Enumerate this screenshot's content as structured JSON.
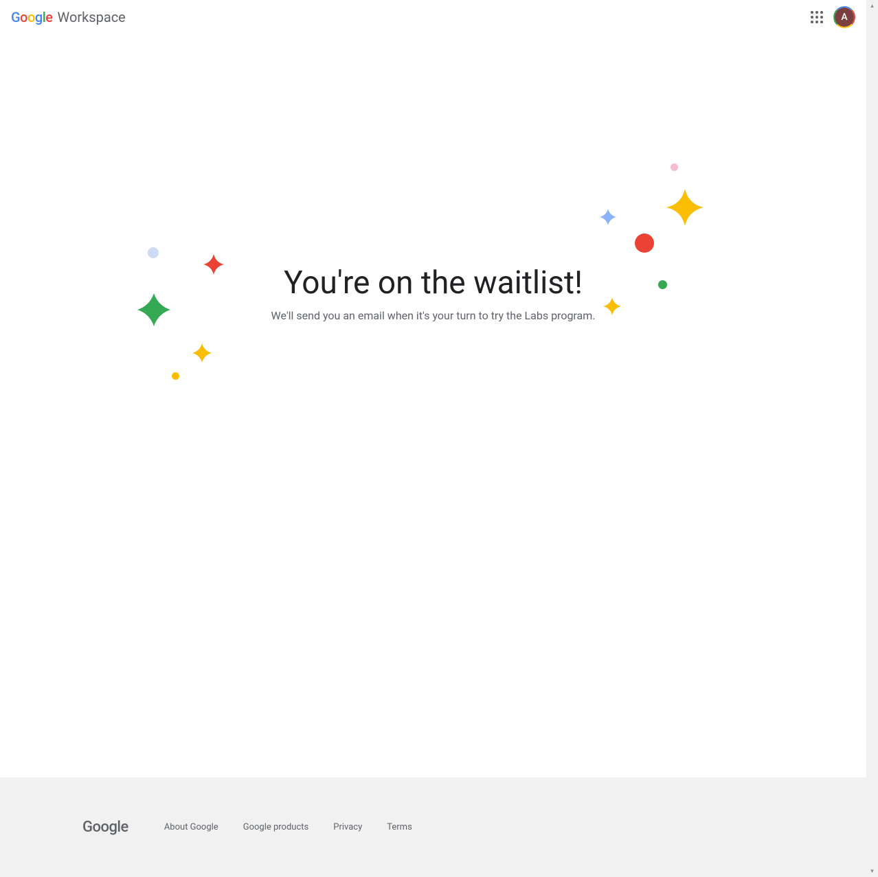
{
  "header": {
    "product": "Workspace",
    "avatar_initial": "A"
  },
  "main": {
    "headline": "You're on the waitlist!",
    "subhead": "We'll send you an email when it's your turn to try the Labs program."
  },
  "footer": {
    "logo": "Google",
    "links": [
      "About Google",
      "Google products",
      "Privacy",
      "Terms"
    ]
  },
  "colors": {
    "blue": "#4285F4",
    "red": "#EA4335",
    "yellow": "#FBBC04",
    "green": "#34A853",
    "pink": "#F8BBD0",
    "lightblue": "#cddcf5",
    "periwinkle": "#8ab4f8"
  }
}
